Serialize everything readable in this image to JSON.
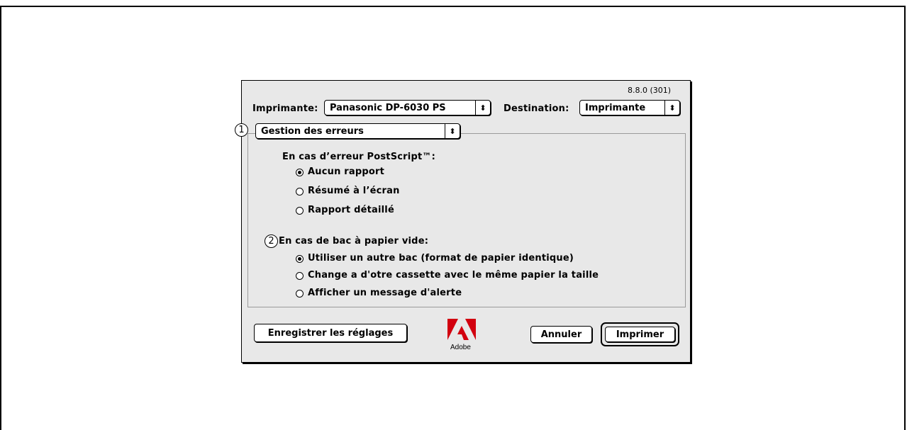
{
  "version": "8.8.0 (301)",
  "printer_label": "Imprimante:",
  "printer_value": "Panasonic DP-6030 PS",
  "destination_label": "Destination:",
  "destination_value": "Imprimante",
  "panel_value": "Gestion des erreurs",
  "marker_1": "1",
  "marker_2": "2",
  "postscript": {
    "title": "En cas d’erreur PostScript™:",
    "options": [
      "Aucun rapport",
      "Résumé à l’écran",
      "Rapport détaillé"
    ],
    "selected": 0
  },
  "empty_tray": {
    "title": "En cas de bac à papier vide:",
    "options": [
      "Utiliser un autre bac (format de papier identique)",
      "Change a d'otre cassette avec le même papier la taille",
      "Afficher un message d'alerte"
    ],
    "selected": 0
  },
  "buttons": {
    "save": "Enregistrer les réglages",
    "cancel": "Annuler",
    "print": "Imprimer"
  },
  "logo_text": "Adobe",
  "popup_arrow_icon": "up-down-arrows-icon"
}
